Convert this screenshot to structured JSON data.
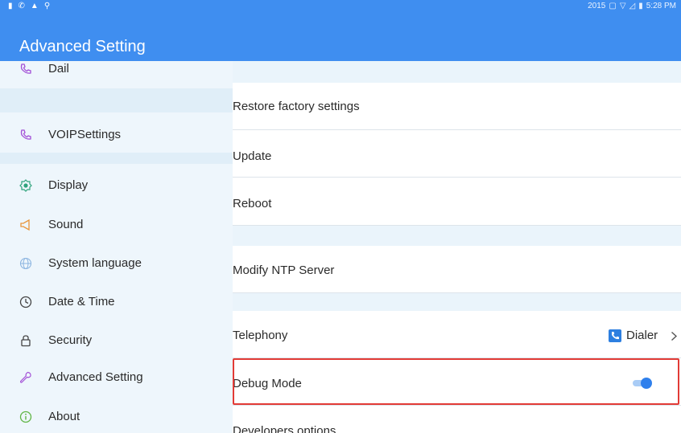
{
  "statusbar": {
    "left_icons": [
      "sim-icon",
      "call-icon",
      "warning-icon",
      "location-icon"
    ],
    "right_text": "2015",
    "time": "5:28 PM"
  },
  "appbar": {
    "title": "Advanced Setting"
  },
  "sidebar": {
    "items": [
      {
        "label": "Dail",
        "icon": "phone-icon"
      },
      {
        "label": "VOIPSettings",
        "icon": "phone-icon"
      },
      {
        "label": "Display",
        "icon": "brightness-icon"
      },
      {
        "label": "Sound",
        "icon": "speaker-icon"
      },
      {
        "label": "System language",
        "icon": "globe-icon"
      },
      {
        "label": "Date & Time",
        "icon": "clock-icon"
      },
      {
        "label": "Security",
        "icon": "lock-icon"
      },
      {
        "label": "Advanced Setting",
        "icon": "wrench-icon"
      },
      {
        "label": "About",
        "icon": "info-icon"
      }
    ]
  },
  "content": {
    "rows": [
      {
        "label": "Restore factory settings"
      },
      {
        "label": "Update"
      },
      {
        "label": "Reboot"
      },
      {
        "label": "Modify NTP Server"
      },
      {
        "label": "Telephony",
        "value": "Dialer"
      },
      {
        "label": "Debug Mode",
        "toggle": true
      },
      {
        "label": "Developers options"
      }
    ]
  },
  "colors": {
    "accent": "#3f8ef0",
    "highlight": "#e23b36",
    "sidebar_bg": "#eef6fc",
    "band_bg": "#eaf4fb"
  }
}
